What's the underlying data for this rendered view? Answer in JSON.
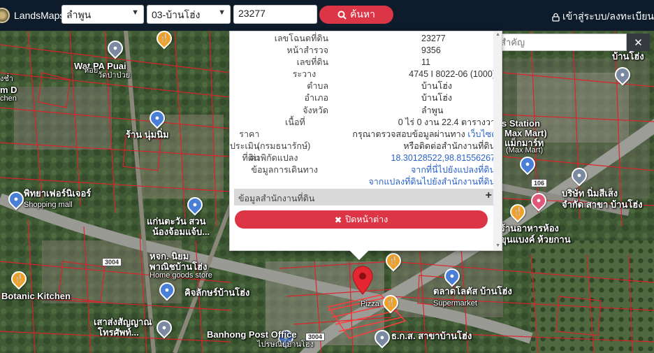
{
  "navbar": {
    "brand": "LandsMaps",
    "province": "ลำพูน",
    "district": "03-บ้านโฮ่ง",
    "search_value": "23277",
    "search_button": "ค้นหา",
    "login": "เข้าสู่ระบบ/ลงทะเบียน"
  },
  "place_search": {
    "placeholder": "ค้นหาสถานที่สำคัญ",
    "close": "✕"
  },
  "popup": {
    "rows": [
      {
        "k": "เลขโฉนดที่ดิน",
        "v": "23277"
      },
      {
        "k": "หน้าสำรวจ",
        "v": "9356"
      },
      {
        "k": "เลขที่ดิน",
        "v": "11"
      },
      {
        "k": "ระวาง",
        "v": "4745 I 8022-06 (1000)"
      },
      {
        "k": "ตำบล",
        "v": "บ้านโฮ่ง"
      },
      {
        "k": "อำเภอ",
        "v": "บ้านโฮ่ง"
      },
      {
        "k": "จังหวัด",
        "v": "ลำพูน"
      },
      {
        "k": "เนื้อที่",
        "v": "0 ไร่ 0 งาน 22.4 ตารางวา"
      }
    ],
    "price_label": "ราคาประเมินที่ดิน",
    "price_text": "กรุณาตรวจสอบข้อมูลผ่านทาง",
    "price_link": "เว็บไซต์กรมธนารักษ์",
    "price_label2": "(กรมธนารักษ์)",
    "price_text2": "หรือติดต่อสำนักงานที่ดิน",
    "coord_label": "ค่าพิกัดแปลง",
    "coord_value": "18.30128522,98.81556267",
    "travel_label": "ข้อมูลการเดินทาง",
    "travel_link1": "จากที่นี่ไปยังแปลงที่ดิน",
    "travel_link2": "จากแปลงที่ดินไปยังสำนักงานที่ดิน",
    "office_label": "ข้อมูลสำนักงานที่ดิน",
    "office_plus": "+",
    "close_button": "ปิดหน้าต่าง"
  },
  "map": {
    "labels": {
      "wat_pa_puai": "Wat PA Puai",
      "wat_pa_puai_th": "วัดป่าป่วย",
      "ran_num_nim": "ร้าน นุ่มนิ่ม",
      "furniture_th": "พิทยาเฟอร์นิเจอร์",
      "shopping_mall": "Shopping mall",
      "kaen_ta_wan": "แก่นตะวัน สวน",
      "kaen_ta_wan2": "น้องจ้อมแจ้บ...",
      "hokkaido_th": "หจก. นิยม",
      "hokkaido_th2": "พาณิชบ้านโฮ่ง",
      "home_goods": "Home goods store",
      "botanic_kitchen": "Botanic Kitchen",
      "chicken_th": "คิจลักษร์บ้านโฮ่ง",
      "sala_th": "เสาส่งสัญญาณ",
      "sala_th2": "โทรศัพท์...",
      "banhong_post": "Banhong Post Office",
      "banhong_post_th": "ไปรษณีย์บ้านโฮ่ง",
      "pizza": "Pizza",
      "talad_lotus": "ตลาดโลตัส บ้านโฮ่ง",
      "supermarket": "Supermarket",
      "baac": "ธ.ก.ส. สาขาบ้านโฮ่ง",
      "station": "s Station",
      "max_mart": "Max Mart)",
      "max_mart_th": "แม็กมาร์ท",
      "max_mart_en": "(Max Mart)",
      "nim_see_seng": "บริษัท นิ่มสีเส็ง",
      "nim_see_seng2": "จำกัด สาขา บ้านโฮ่ง",
      "restaurant_th": "ร้านอาหารห้อง",
      "restaurant_th2": "ขุนแบงค์ ห้วยกาน",
      "banhong_th": "บ้านโฮ่ง",
      "left_top1": "งช่ำ",
      "left_top2": "m D",
      "left_top3": "chen",
      "left_top4": "ห้อย"
    },
    "road_shields": [
      "3004",
      "3004",
      "106"
    ]
  }
}
